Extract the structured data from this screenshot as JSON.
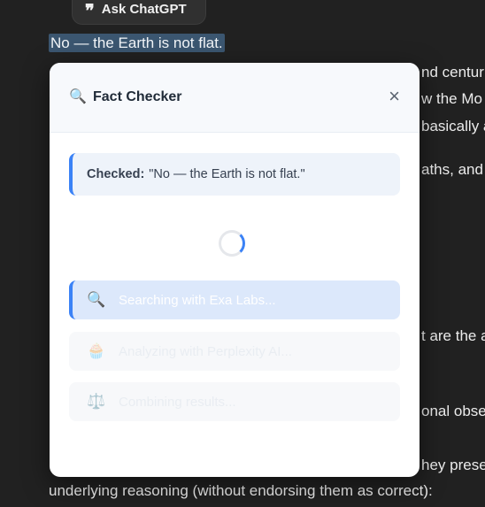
{
  "background": {
    "highlighted_line": "No — the Earth is not flat.",
    "partial_lines": [
      "nd centur",
      "w the Mo",
      "basically a",
      "aths, and",
      "t are the a",
      "onal obse",
      "hey prese",
      "underlying reasoning (without endorsing them as correct):"
    ]
  },
  "ask_chatgpt": {
    "label": "Ask ChatGPT",
    "icon": "quote-icon"
  },
  "modal": {
    "title": "Fact Checker",
    "title_icon": "search-icon",
    "close_label": "×",
    "checked": {
      "label": "Checked:",
      "text": "\"No — the Earth is not flat.\""
    },
    "steps": [
      {
        "icon": "search-icon",
        "glyph": "🔍",
        "label": "Searching with Exa Labs...",
        "state": "active"
      },
      {
        "icon": "cake-icon",
        "glyph": "🧁",
        "label": "Analyzing with Perplexity AI...",
        "state": "pending"
      },
      {
        "icon": "scale-icon",
        "glyph": "⚖️",
        "label": "Combining results...",
        "state": "pending"
      }
    ]
  },
  "colors": {
    "page_bg": "#212121",
    "highlight": "#3b5670",
    "accent": "#3b82f6",
    "modal_bg": "#ffffff"
  }
}
